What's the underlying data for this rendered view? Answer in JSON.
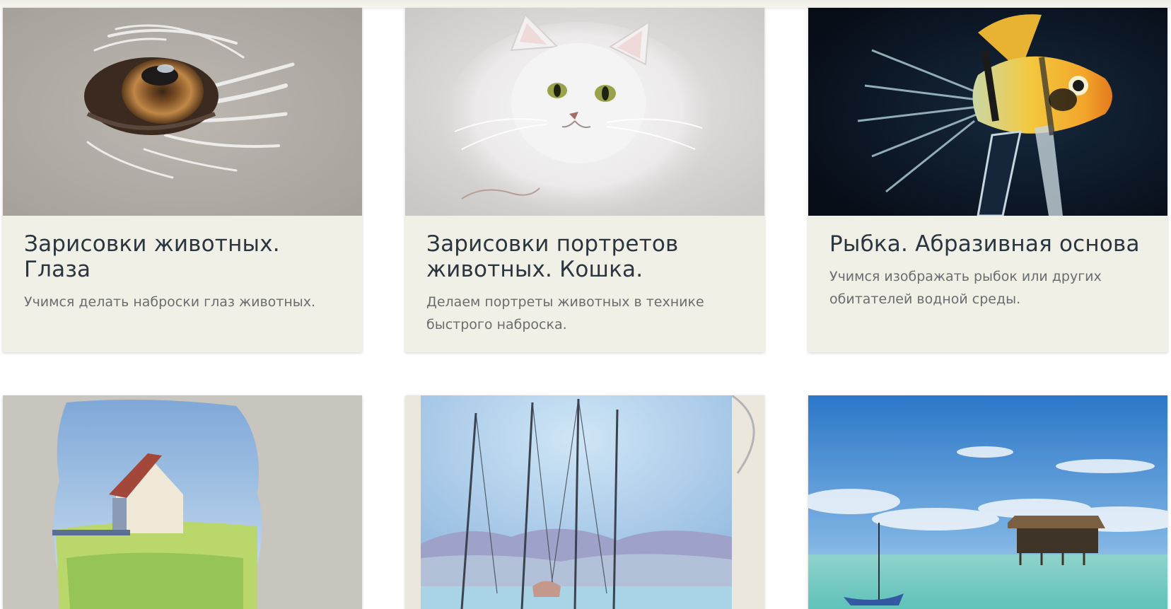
{
  "cards": [
    {
      "title": "Зарисовки животных. Глаза",
      "description": "Учимся делать наброски глаз животных.",
      "image": "animal-eye-pastel-image"
    },
    {
      "title": "Зарисовки портретов животных. Кошка.",
      "description": "Делаем портреты животных в технике быстрого наброска.",
      "image": "white-cat-pastel-image"
    },
    {
      "title": "Рыбка. Абразивная основа",
      "description": "Учимся изображать рыбок или других обитателей водной среды.",
      "image": "angelfish-pastel-image"
    },
    {
      "image": "house-landscape-pastel-image"
    },
    {
      "image": "sailboats-pastel-image"
    },
    {
      "image": "sea-hut-pastel-image"
    }
  ],
  "colors": {
    "card_background": "#f1f0e6",
    "title": "#2b3540",
    "description": "#6a6d70"
  }
}
